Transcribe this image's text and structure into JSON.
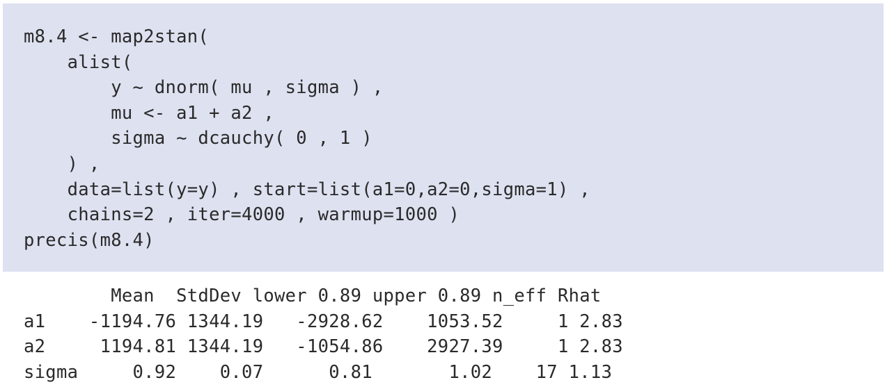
{
  "code": {
    "lines": [
      "m8.4 <- map2stan(",
      "    alist(",
      "        y ~ dnorm( mu , sigma ) ,",
      "        mu <- a1 + a2 ,",
      "        sigma ~ dcauchy( 0 , 1 )",
      "    ) ,",
      "    data=list(y=y) , start=list(a1=0,a2=0,sigma=1) ,",
      "    chains=2 , iter=4000 , warmup=1000 )",
      "precis(m8.4)"
    ]
  },
  "output": {
    "lines": [
      "        Mean  StdDev lower 0.89 upper 0.89 n_eff Rhat",
      "a1    -1194.76 1344.19   -2928.62    1053.52     1 2.83",
      "a2     1194.81 1344.19   -1054.86    2927.39     1 2.83",
      "sigma     0.92    0.07      0.81       1.02    17 1.13"
    ]
  },
  "colors": {
    "code_background": "#dde1f0",
    "text": "#2a2a2a"
  }
}
